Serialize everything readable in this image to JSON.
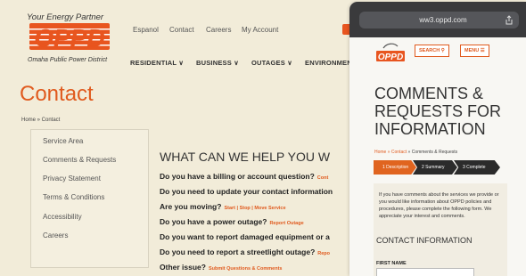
{
  "header": {
    "tagline": "Your Energy Partner",
    "logo_text": "OPPD",
    "district": "Omaha Public Power District",
    "util_links": [
      "Espanol",
      "Contact",
      "Careers",
      "My Account"
    ],
    "nav": [
      "RESIDENTIAL ∨",
      "BUSINESS ∨",
      "OUTAGES ∨",
      "ENVIRONMEN"
    ]
  },
  "page": {
    "title": "Contact",
    "breadcrumb": "Home  »  Contact"
  },
  "sidebar": {
    "items": [
      "Service Area",
      "Comments & Requests",
      "Privacy Statement",
      "Terms & Conditions",
      "Accessibility",
      "Careers"
    ]
  },
  "main": {
    "heading": "WHAT CAN WE HELP YOU W",
    "questions": [
      {
        "q": "Do you have a billing or account question?",
        "link": "Cont"
      },
      {
        "q": "Do you need to update your contact information",
        "link": ""
      },
      {
        "q": "Are you moving?",
        "link": "Start | Stop | Move Service"
      },
      {
        "q": "Do you have a power outage?",
        "link": "Report Outage"
      },
      {
        "q": "Do you want to report damaged equipment or a",
        "link": ""
      },
      {
        "q": "Do you need to report a streetlight outage?",
        "link": "Repo"
      },
      {
        "q": "Other issue?",
        "link": "Submit Questions & Comments"
      }
    ]
  },
  "phone": {
    "url": "ww3.oppd.com",
    "search_label": "SEARCH",
    "menu_label": "MENU",
    "title": "COMMENTS & REQUESTS FOR INFORMATION",
    "crumb_home": "Home",
    "crumb_contact": "Contact",
    "crumb_current": "Comments & Requests",
    "steps": [
      "1  Description",
      "2  Summary",
      "3  Complete"
    ],
    "intro": "If you have comments about the services we provide or you would like information about OPPD policies and procedures, please complete the following form. We appreciate your interest and comments.",
    "section": "CONTACT INFORMATION",
    "first_name_label": "FIRST NAME",
    "colors": {
      "accent": "#e05a1e",
      "step_active": "#e0641f",
      "step_dark": "#2b2b2b"
    }
  }
}
